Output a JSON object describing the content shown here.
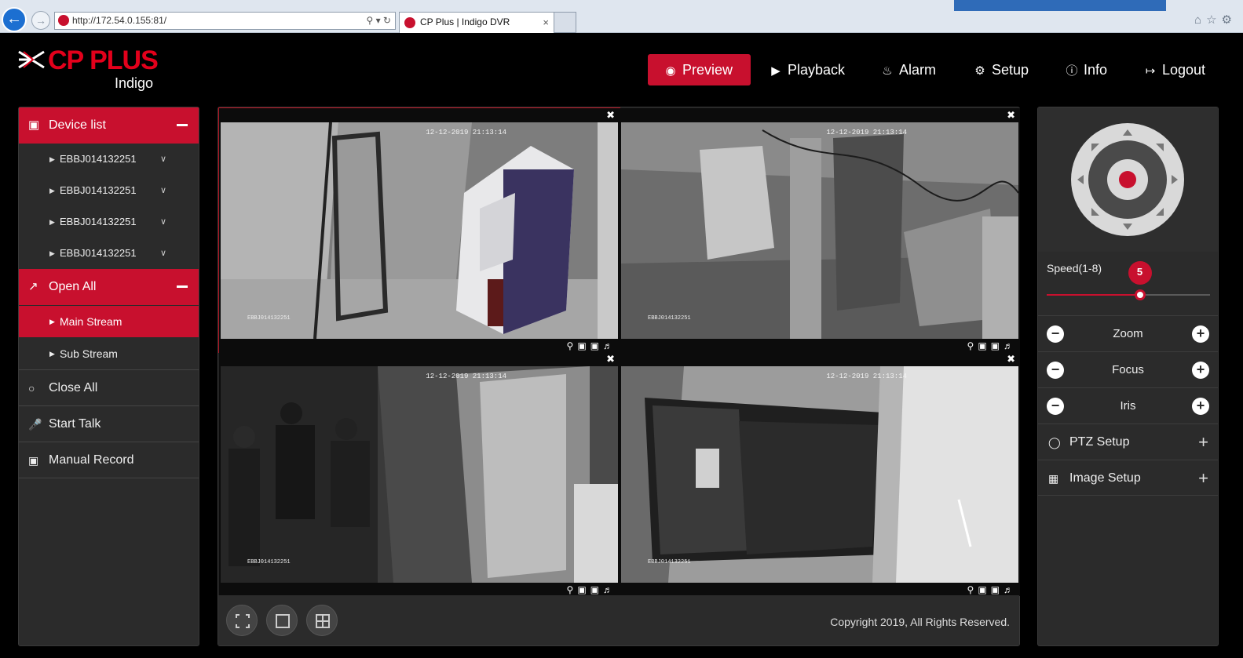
{
  "browser": {
    "url": "http://172.54.0.155:81/",
    "tab_title": "CP Plus | Indigo DVR",
    "tab_close": "×"
  },
  "header": {
    "brand": "CP PLUS",
    "sub_brand": "Indigo",
    "nav": [
      {
        "label": "Preview",
        "icon": "eye-icon",
        "active": true
      },
      {
        "label": "Playback",
        "icon": "play-icon",
        "active": false
      },
      {
        "label": "Alarm",
        "icon": "bell-icon",
        "active": false
      },
      {
        "label": "Setup",
        "icon": "gear-icon",
        "active": false
      },
      {
        "label": "Info",
        "icon": "info-icon",
        "active": false
      },
      {
        "label": "Logout",
        "icon": "logout-icon",
        "active": false
      }
    ]
  },
  "sidebar": {
    "device_list_title": "Device list",
    "devices": [
      "EBBJ014132251",
      "EBBJ014132251",
      "EBBJ014132251",
      "EBBJ014132251"
    ],
    "open_all_title": "Open All",
    "streams": [
      {
        "label": "Main Stream",
        "active": true
      },
      {
        "label": "Sub Stream",
        "active": false
      }
    ],
    "actions": [
      {
        "label": "Close All",
        "icon": "circle-icon"
      },
      {
        "label": "Start Talk",
        "icon": "microphone-icon"
      },
      {
        "label": "Manual Record",
        "icon": "video-camera-icon"
      }
    ]
  },
  "cameras": [
    {
      "timestamp": "12-12-2019 21:13:14",
      "cam_id": "EBBJ014132251",
      "selected": true
    },
    {
      "timestamp": "12-12-2019 21:13:14",
      "cam_id": "EBBJ014132251",
      "selected": false
    },
    {
      "timestamp": "12-12-2019 21:13:14",
      "cam_id": "EBBJ014132251",
      "selected": false
    },
    {
      "timestamp": "12-12-2019 21:13:14",
      "cam_id": "EBBJ014132251",
      "selected": false
    }
  ],
  "footer": {
    "copyright": "Copyright 2019, All Rights Reserved."
  },
  "ptz": {
    "speed_label": "Speed(1-8)",
    "speed_value": "5",
    "speed_fraction": 0.57,
    "rows": [
      "Zoom",
      "Focus",
      "Iris"
    ],
    "setups": [
      {
        "label": "PTZ Setup",
        "icon": "gamepad-icon"
      },
      {
        "label": "Image Setup",
        "icon": "image-icon"
      }
    ]
  },
  "colors": {
    "accent": "#c8102e",
    "panel": "#2b2b2b",
    "background": "#000000"
  }
}
